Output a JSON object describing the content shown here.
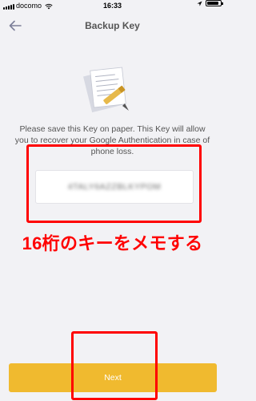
{
  "status_bar": {
    "carrier": "docomo",
    "time": "16:33",
    "icons": [
      "signal-icon",
      "wifi-icon",
      "location-icon",
      "battery-icon"
    ],
    "battery_level": 0.85
  },
  "nav": {
    "title": "Backup Key",
    "back_icon": "arrow-left-icon"
  },
  "illustration": "paper-and-pen-icon",
  "instructions": "Please save this Key on paper. This Key will allow you to recover your Google Authentication in case of phone loss.",
  "backup_key": "4TALY6AZZBLKYPOM",
  "annotation": "16桁のキーをメモする",
  "next_button": {
    "label": "Next"
  },
  "colors": {
    "background": "#f2f2f5",
    "accent": "#f0ba2f",
    "annotation_red": "#ff0000"
  }
}
